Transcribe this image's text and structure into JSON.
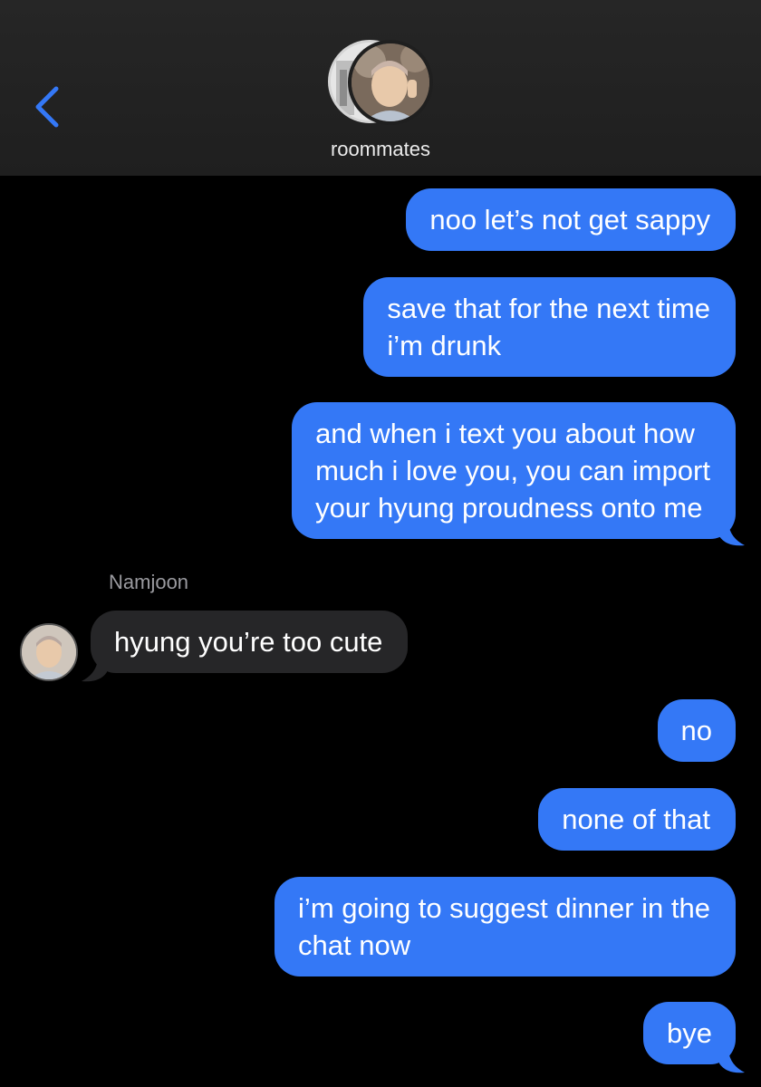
{
  "header": {
    "title": "roommates",
    "back_icon": "chevron-left-icon",
    "accent_color": "#3478f6"
  },
  "conversation": {
    "sent_color": "#3478f6",
    "received_color": "#262628",
    "sender_name": "Namjoon",
    "messages": [
      {
        "from": "me",
        "text": "noo let’s not get sappy"
      },
      {
        "from": "me",
        "text": "save that for the next time\ni’m drunk"
      },
      {
        "from": "me",
        "text": "and when i text you about how\nmuch i love you, you can import\nyour hyung proudness onto me"
      },
      {
        "from": "Namjoon",
        "text": "hyung you’re too cute"
      },
      {
        "from": "me",
        "text": "no"
      },
      {
        "from": "me",
        "text": "none of that"
      },
      {
        "from": "me",
        "text": "i’m going to suggest dinner in the\nchat now"
      },
      {
        "from": "me",
        "text": "bye"
      }
    ]
  }
}
